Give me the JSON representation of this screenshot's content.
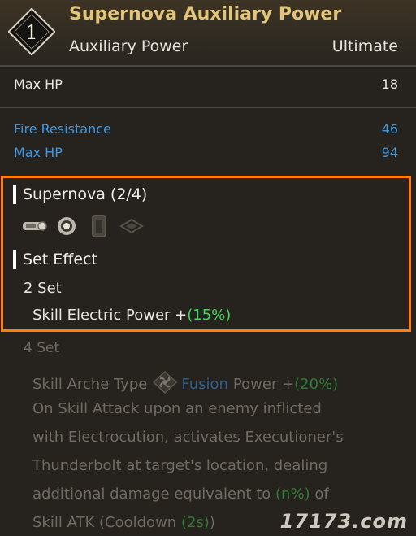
{
  "header": {
    "rank": "1",
    "title": "Supernova Auxiliary Power",
    "subtitle": "Auxiliary Power",
    "category": "Ultimate"
  },
  "base_stat": {
    "label": "Max HP",
    "value": "18"
  },
  "sub_stats": [
    {
      "label": "Fire Resistance",
      "value": "46"
    },
    {
      "label": "Max HP",
      "value": "94"
    }
  ],
  "set": {
    "name": "Supernova (2/4)",
    "piece_icons": [
      "core-piece-icon",
      "auxiliary-power-piece-icon",
      "sensor-piece-icon",
      "memory-piece-icon"
    ],
    "effect_heading": "Set Effect",
    "two_set": {
      "label": "2 Set",
      "effect_text": "Skill Electric Power +",
      "effect_value": "(15%)"
    },
    "four_set": {
      "label": "4 Set",
      "arche_prefix": "Skill Arche Type",
      "arche_icon": "fusion-icon",
      "arche_name": "Fusion",
      "arche_suffix": "Power +",
      "arche_value": "(20%)",
      "desc_line1": "On Skill Attack upon an enemy inflicted",
      "desc_line2": "with Electrocution, activates Executioner's",
      "desc_line3": "Thunderbolt at target's location, dealing",
      "desc_line4_pre": "additional damage equivalent to",
      "desc_line4_value": "(n%)",
      "desc_line4_post": "of",
      "desc_line5_pre": "Skill ATK (Cooldown",
      "desc_line5_value": "(2s)",
      "desc_line5_post": ")"
    }
  },
  "watermark": "17173.com",
  "colors": {
    "accent_gold": "#e2c47a",
    "highlight_border": "#ff7e0d",
    "stat_blue": "#3f97e0",
    "bonus_green": "#3fd85a"
  }
}
